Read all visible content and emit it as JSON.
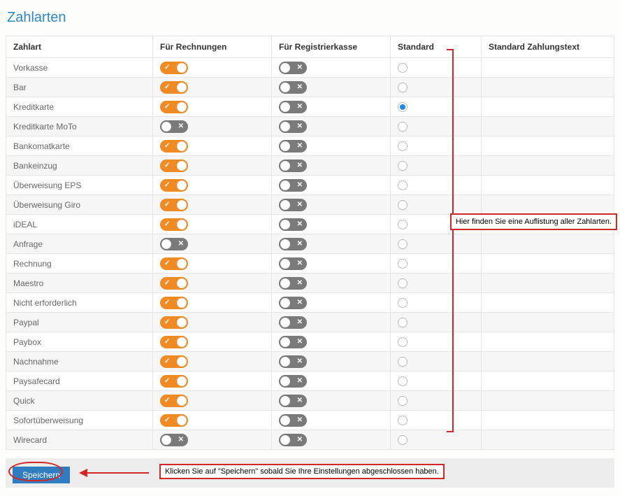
{
  "title": "Zahlarten",
  "columns": {
    "name": "Zahlart",
    "invoices": "Für Rechnungen",
    "register": "Für Registrierkasse",
    "standard": "Standard",
    "text": "Standard Zahlungstext"
  },
  "rows": [
    {
      "name": "Vorkasse",
      "inv": true,
      "reg": false,
      "std": false,
      "text": ""
    },
    {
      "name": "Bar",
      "inv": true,
      "reg": false,
      "std": false,
      "text": ""
    },
    {
      "name": "Kreditkarte",
      "inv": true,
      "reg": false,
      "std": true,
      "text": ""
    },
    {
      "name": "Kreditkarte MoTo",
      "inv": false,
      "reg": false,
      "std": false,
      "text": ""
    },
    {
      "name": "Bankomatkarte",
      "inv": true,
      "reg": false,
      "std": false,
      "text": ""
    },
    {
      "name": "Bankeinzug",
      "inv": true,
      "reg": false,
      "std": false,
      "text": ""
    },
    {
      "name": "Überweisung EPS",
      "inv": true,
      "reg": false,
      "std": false,
      "text": ""
    },
    {
      "name": "Überweisung Giro",
      "inv": true,
      "reg": false,
      "std": false,
      "text": ""
    },
    {
      "name": "iDEAL",
      "inv": true,
      "reg": false,
      "std": false,
      "text": ""
    },
    {
      "name": "Anfrage",
      "inv": false,
      "reg": false,
      "std": false,
      "text": ""
    },
    {
      "name": "Rechnung",
      "inv": true,
      "reg": false,
      "std": false,
      "text": ""
    },
    {
      "name": "Maestro",
      "inv": true,
      "reg": false,
      "std": false,
      "text": ""
    },
    {
      "name": "Nicht erforderlich",
      "inv": true,
      "reg": false,
      "std": false,
      "text": ""
    },
    {
      "name": "Paypal",
      "inv": true,
      "reg": false,
      "std": false,
      "text": ""
    },
    {
      "name": "Paybox",
      "inv": true,
      "reg": false,
      "std": false,
      "text": ""
    },
    {
      "name": "Nachnahme",
      "inv": true,
      "reg": false,
      "std": false,
      "text": ""
    },
    {
      "name": "Paysafecard",
      "inv": true,
      "reg": false,
      "std": false,
      "text": ""
    },
    {
      "name": "Quick",
      "inv": true,
      "reg": false,
      "std": false,
      "text": ""
    },
    {
      "name": "Sofortüberweisung",
      "inv": true,
      "reg": false,
      "std": false,
      "text": ""
    },
    {
      "name": "Wirecard",
      "inv": false,
      "reg": false,
      "std": false,
      "text": ""
    }
  ],
  "save_label": "Speichern",
  "annotations": {
    "list_hint": "Hier finden Sie eine Auflistung aller Zahlarten.",
    "save_hint": "Klicken Sie auf \"Speichern\" sobald Sie Ihre Einstellungen abgeschlossen haben."
  }
}
